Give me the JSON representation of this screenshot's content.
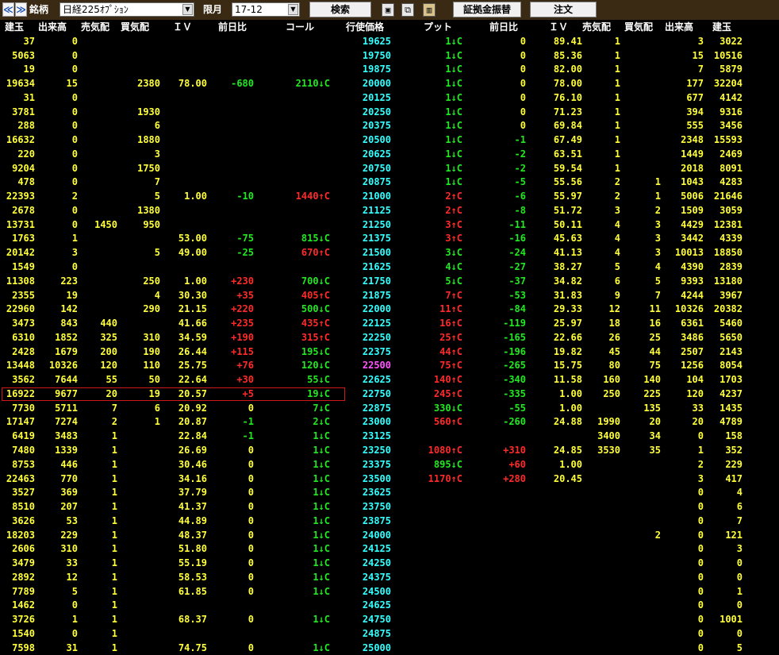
{
  "toolbar": {
    "prev_label": "≪",
    "next_label": "≫",
    "symbol_label": "銘柄",
    "symbol_value": "日経225ｵﾌﾟｼｮﾝ",
    "month_label": "限月",
    "month_value": "17-12",
    "search_label": "検索",
    "transfer_label": "証拠金振替",
    "order_label": "注文"
  },
  "headers": {
    "call_oi": "建玉",
    "call_volume": "出来高",
    "call_ask": "売気配",
    "call_bid": "買気配",
    "call_iv": "ＩＶ",
    "call_change": "前日比",
    "call_price": "コール",
    "strike": "行使価格",
    "put_price": "プット",
    "put_change": "前日比",
    "put_iv": "ＩＶ",
    "put_ask": "売気配",
    "put_bid": "買気配",
    "put_volume": "出来高",
    "put_oi": "建玉"
  },
  "colors": {
    "up": "#ff2a2a",
    "down": "#22e822",
    "value": "#ffff3a",
    "strike": "#33ffff",
    "atm_strike": "#ff55ff"
  },
  "selected_row_index": 25,
  "rows": [
    [
      "37",
      "0",
      "",
      "",
      "",
      "",
      "",
      "19625",
      "1↓C",
      "0",
      "89.41",
      "1",
      "",
      "3",
      "3022"
    ],
    [
      "5063",
      "0",
      "",
      "",
      "",
      "",
      "",
      "19750",
      "1↓C",
      "0",
      "85.36",
      "1",
      "",
      "15",
      "10516"
    ],
    [
      "19",
      "0",
      "",
      "",
      "",
      "",
      "",
      "19875",
      "1↓C",
      "0",
      "82.00",
      "1",
      "",
      "7",
      "5879"
    ],
    [
      "19634",
      "15",
      "",
      "2380",
      "78.00",
      "-680",
      "2110↓C",
      "20000",
      "1↓C",
      "0",
      "78.00",
      "1",
      "",
      "177",
      "32204"
    ],
    [
      "31",
      "0",
      "",
      "",
      "",
      "",
      "",
      "20125",
      "1↓C",
      "0",
      "76.10",
      "1",
      "",
      "677",
      "4142"
    ],
    [
      "3781",
      "0",
      "",
      "1930",
      "",
      "",
      "",
      "20250",
      "1↓C",
      "0",
      "71.23",
      "1",
      "",
      "394",
      "9316"
    ],
    [
      "288",
      "0",
      "",
      "6",
      "",
      "",
      "",
      "20375",
      "1↓C",
      "0",
      "69.84",
      "1",
      "",
      "555",
      "3456"
    ],
    [
      "16632",
      "0",
      "",
      "1880",
      "",
      "",
      "",
      "20500",
      "1↓C",
      "-1",
      "67.49",
      "1",
      "",
      "2348",
      "15593"
    ],
    [
      "220",
      "0",
      "",
      "3",
      "",
      "",
      "",
      "20625",
      "1↓C",
      "-2",
      "63.51",
      "1",
      "",
      "1449",
      "2469"
    ],
    [
      "9204",
      "0",
      "",
      "1750",
      "",
      "",
      "",
      "20750",
      "1↓C",
      "-2",
      "59.54",
      "1",
      "",
      "2018",
      "8091"
    ],
    [
      "478",
      "0",
      "",
      "7",
      "",
      "",
      "",
      "20875",
      "1↓C",
      "-5",
      "55.56",
      "2",
      "1",
      "1043",
      "4283"
    ],
    [
      "22393",
      "2",
      "",
      "5",
      "1.00",
      "-10",
      "1440↑C",
      "21000",
      "2↑C",
      "-6",
      "55.97",
      "2",
      "1",
      "5006",
      "21646"
    ],
    [
      "2678",
      "0",
      "",
      "1380",
      "",
      "",
      "",
      "21125",
      "2↑C",
      "-8",
      "51.72",
      "3",
      "2",
      "1509",
      "3059"
    ],
    [
      "13731",
      "0",
      "1450",
      "950",
      "",
      "",
      "",
      "21250",
      "3↑C",
      "-11",
      "50.11",
      "4",
      "3",
      "4429",
      "12381"
    ],
    [
      "1763",
      "1",
      "",
      "",
      "53.00",
      "-75",
      "815↓C",
      "21375",
      "3↑C",
      "-16",
      "45.63",
      "4",
      "3",
      "3442",
      "4339"
    ],
    [
      "20142",
      "3",
      "",
      "5",
      "49.00",
      "-25",
      "670↑C",
      "21500",
      "3↓C",
      "-24",
      "41.13",
      "4",
      "3",
      "10013",
      "18850"
    ],
    [
      "1549",
      "0",
      "",
      "",
      "",
      "",
      "",
      "21625",
      "4↓C",
      "-27",
      "38.27",
      "5",
      "4",
      "4390",
      "2839"
    ],
    [
      "11308",
      "223",
      "",
      "250",
      "1.00",
      "+230",
      "700↓C",
      "21750",
      "5↓C",
      "-37",
      "34.82",
      "6",
      "5",
      "9393",
      "13180"
    ],
    [
      "2355",
      "19",
      "",
      "4",
      "30.30",
      "+35",
      "405↑C",
      "21875",
      "7↑C",
      "-53",
      "31.83",
      "9",
      "7",
      "4244",
      "3967"
    ],
    [
      "22960",
      "142",
      "",
      "290",
      "21.15",
      "+220",
      "500↓C",
      "22000",
      "11↑C",
      "-84",
      "29.33",
      "12",
      "11",
      "10326",
      "20382"
    ],
    [
      "3473",
      "843",
      "440",
      "",
      "41.66",
      "+235",
      "435↑C",
      "22125",
      "16↑C",
      "-119",
      "25.97",
      "18",
      "16",
      "6361",
      "5460"
    ],
    [
      "6310",
      "1852",
      "325",
      "310",
      "34.59",
      "+190",
      "315↑C",
      "22250",
      "25↑C",
      "-165",
      "22.66",
      "26",
      "25",
      "3486",
      "5650"
    ],
    [
      "2428",
      "1679",
      "200",
      "190",
      "26.44",
      "+115",
      "195↓C",
      "22375",
      "44↑C",
      "-196",
      "19.82",
      "45",
      "44",
      "2507",
      "2143"
    ],
    [
      "13448",
      "10326",
      "120",
      "110",
      "25.75",
      "+76",
      "120↓C",
      "22500",
      "75↑C",
      "-265",
      "15.75",
      "80",
      "75",
      "1256",
      "8054"
    ],
    [
      "3562",
      "7644",
      "55",
      "50",
      "22.64",
      "+30",
      "55↓C",
      "22625",
      "140↑C",
      "-340",
      "11.58",
      "160",
      "140",
      "104",
      "1703"
    ],
    [
      "16922",
      "9677",
      "20",
      "19",
      "20.57",
      "+5",
      "19↓C",
      "22750",
      "245↑C",
      "-335",
      "1.00",
      "250",
      "225",
      "120",
      "4237"
    ],
    [
      "7730",
      "5711",
      "7",
      "6",
      "20.92",
      "0",
      "7↓C",
      "22875",
      "330↓C",
      "-55",
      "1.00",
      "",
      "135",
      "33",
      "1435"
    ],
    [
      "17147",
      "7274",
      "2",
      "1",
      "20.87",
      "-1",
      "2↓C",
      "23000",
      "560↑C",
      "-260",
      "24.88",
      "1990",
      "20",
      "20",
      "4789"
    ],
    [
      "6419",
      "3483",
      "1",
      "",
      "22.84",
      "-1",
      "1↓C",
      "23125",
      "",
      "",
      "",
      "3400",
      "34",
      "0",
      "158"
    ],
    [
      "7480",
      "1339",
      "1",
      "",
      "26.69",
      "0",
      "1↓C",
      "23250",
      "1080↑C",
      "+310",
      "24.85",
      "3530",
      "35",
      "1",
      "352"
    ],
    [
      "8753",
      "446",
      "1",
      "",
      "30.46",
      "0",
      "1↓C",
      "23375",
      "895↓C",
      "+60",
      "1.00",
      "",
      "",
      "2",
      "229"
    ],
    [
      "22463",
      "770",
      "1",
      "",
      "34.16",
      "0",
      "1↓C",
      "23500",
      "1170↑C",
      "+280",
      "20.45",
      "",
      "",
      "3",
      "417"
    ],
    [
      "3527",
      "369",
      "1",
      "",
      "37.79",
      "0",
      "1↓C",
      "23625",
      "",
      "",
      "",
      "",
      "",
      "0",
      "4"
    ],
    [
      "8510",
      "207",
      "1",
      "",
      "41.37",
      "0",
      "1↓C",
      "23750",
      "",
      "",
      "",
      "",
      "",
      "0",
      "6"
    ],
    [
      "3626",
      "53",
      "1",
      "",
      "44.89",
      "0",
      "1↓C",
      "23875",
      "",
      "",
      "",
      "",
      "",
      "0",
      "7"
    ],
    [
      "18203",
      "229",
      "1",
      "",
      "48.37",
      "0",
      "1↓C",
      "24000",
      "",
      "",
      "",
      "",
      "2",
      "0",
      "121"
    ],
    [
      "2606",
      "310",
      "1",
      "",
      "51.80",
      "0",
      "1↓C",
      "24125",
      "",
      "",
      "",
      "",
      "",
      "0",
      "3"
    ],
    [
      "3479",
      "33",
      "1",
      "",
      "55.19",
      "0",
      "1↓C",
      "24250",
      "",
      "",
      "",
      "",
      "",
      "0",
      "0"
    ],
    [
      "2892",
      "12",
      "1",
      "",
      "58.53",
      "0",
      "1↓C",
      "24375",
      "",
      "",
      "",
      "",
      "",
      "0",
      "0"
    ],
    [
      "7789",
      "5",
      "1",
      "",
      "61.85",
      "0",
      "1↓C",
      "24500",
      "",
      "",
      "",
      "",
      "",
      "0",
      "1"
    ],
    [
      "1462",
      "0",
      "1",
      "",
      "",
      "",
      "",
      "24625",
      "",
      "",
      "",
      "",
      "",
      "0",
      "0"
    ],
    [
      "3726",
      "1",
      "1",
      "",
      "68.37",
      "0",
      "1↓C",
      "24750",
      "",
      "",
      "",
      "",
      "",
      "0",
      "1001"
    ],
    [
      "1540",
      "0",
      "1",
      "",
      "",
      "",
      "",
      "24875",
      "",
      "",
      "",
      "",
      "",
      "0",
      "0"
    ],
    [
      "7598",
      "31",
      "1",
      "",
      "74.75",
      "0",
      "1↓C",
      "25000",
      "",
      "",
      "",
      "",
      "",
      "0",
      "5"
    ]
  ]
}
